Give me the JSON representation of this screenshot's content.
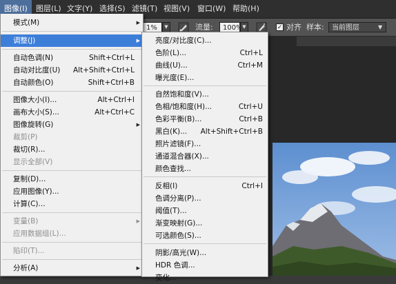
{
  "menubar": {
    "items": [
      {
        "label": "图像(I)"
      },
      {
        "label": "图层(L)"
      },
      {
        "label": "文字(Y)"
      },
      {
        "label": "选择(S)"
      },
      {
        "label": "滤镜(T)"
      },
      {
        "label": "视图(V)"
      },
      {
        "label": "窗口(W)"
      },
      {
        "label": "帮助(H)"
      }
    ]
  },
  "options_bar": {
    "opacity_value": "1%",
    "flow_label": "流量:",
    "flow_value": "100%",
    "align_label": "对齐",
    "sample_label": "样本:",
    "sample_value": "当前图层",
    "align_checked": "✓"
  },
  "image_menu": {
    "items": [
      {
        "label": "模式(M)",
        "shortcut": "",
        "submenu": true
      },
      {
        "label": "调整(J)",
        "shortcut": "",
        "submenu": true
      },
      {
        "label": "自动色调(N)",
        "shortcut": "Shift+Ctrl+L"
      },
      {
        "label": "自动对比度(U)",
        "shortcut": "Alt+Shift+Ctrl+L"
      },
      {
        "label": "自动颜色(O)",
        "shortcut": "Shift+Ctrl+B"
      },
      {
        "label": "图像大小(I)...",
        "shortcut": "Alt+Ctrl+I"
      },
      {
        "label": "画布大小(S)...",
        "shortcut": "Alt+Ctrl+C"
      },
      {
        "label": "图像旋转(G)",
        "shortcut": "",
        "submenu": true
      },
      {
        "label": "裁剪(P)",
        "shortcut": ""
      },
      {
        "label": "裁切(R)...",
        "shortcut": ""
      },
      {
        "label": "显示全部(V)",
        "shortcut": ""
      },
      {
        "label": "复制(D)...",
        "shortcut": ""
      },
      {
        "label": "应用图像(Y)...",
        "shortcut": ""
      },
      {
        "label": "计算(C)...",
        "shortcut": ""
      },
      {
        "label": "变量(B)",
        "shortcut": "",
        "submenu": true
      },
      {
        "label": "应用数据组(L)...",
        "shortcut": ""
      },
      {
        "label": "陷印(T)...",
        "shortcut": ""
      },
      {
        "label": "分析(A)",
        "shortcut": "",
        "submenu": true
      }
    ]
  },
  "adjust_submenu": {
    "items": [
      {
        "label": "亮度/对比度(C)...",
        "shortcut": ""
      },
      {
        "label": "色阶(L)...",
        "shortcut": "Ctrl+L"
      },
      {
        "label": "曲线(U)...",
        "shortcut": "Ctrl+M"
      },
      {
        "label": "曝光度(E)...",
        "shortcut": ""
      },
      {
        "label": "自然饱和度(V)...",
        "shortcut": ""
      },
      {
        "label": "色相/饱和度(H)...",
        "shortcut": "Ctrl+U"
      },
      {
        "label": "色彩平衡(B)...",
        "shortcut": "Ctrl+B"
      },
      {
        "label": "黑白(K)...",
        "shortcut": "Alt+Shift+Ctrl+B"
      },
      {
        "label": "照片滤镜(F)...",
        "shortcut": ""
      },
      {
        "label": "通道混合器(X)...",
        "shortcut": ""
      },
      {
        "label": "颜色查找...",
        "shortcut": ""
      },
      {
        "label": "反相(I)",
        "shortcut": "Ctrl+I"
      },
      {
        "label": "色调分离(P)...",
        "shortcut": ""
      },
      {
        "label": "阈值(T)...",
        "shortcut": ""
      },
      {
        "label": "渐变映射(G)...",
        "shortcut": ""
      },
      {
        "label": "可选颜色(S)...",
        "shortcut": ""
      },
      {
        "label": "阴影/高光(W)...",
        "shortcut": ""
      },
      {
        "label": "HDR 色调...",
        "shortcut": ""
      },
      {
        "label": "变化...",
        "shortcut": ""
      }
    ]
  }
}
